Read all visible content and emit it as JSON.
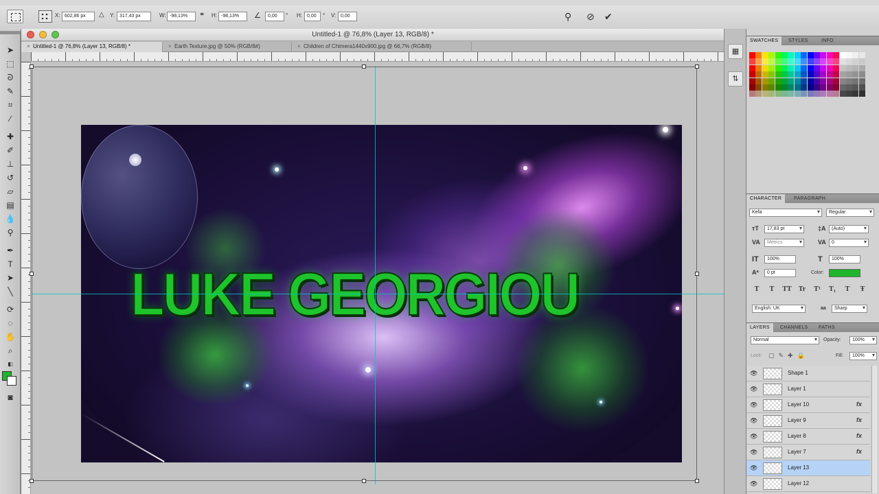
{
  "options_bar": {
    "x_label": "X:",
    "x_value": "602,86 px",
    "y_label": "Y:",
    "y_value": "317,43 px",
    "w_label": "W:",
    "w_value": "-98,13%",
    "h_label": "H:",
    "h_value": "-98,13%",
    "angle_value": "0,00",
    "hskew_label": "H:",
    "hskew_value": "0,00",
    "vskew_label": "V:",
    "vskew_value": "0,00",
    "degree_symbol": "°",
    "degree_symbol_2": "°",
    "warp_icon": "warp-mode-icon",
    "cancel_icon": "cancel-transform-icon",
    "commit_icon": "commit-transform-icon"
  },
  "document": {
    "title": "Untitled-1 @ 76,8% (Layer 13, RGB/8) *",
    "tabs": [
      {
        "label": "Untitled-1 @ 76,8% (Layer 13, RGB/8) *",
        "active": true
      },
      {
        "label": "Earth Texture.jpg @ 50% (RGB/8#)",
        "active": false
      },
      {
        "label": "Children of Chimera1440x900.jpg @ 66,7% (RGB/8)",
        "active": false
      }
    ],
    "canvas_text": "LUKE GEORGIOU"
  },
  "panels": {
    "swatches_tabs": [
      "SWATCHES",
      "STYLES",
      "INFO"
    ],
    "character_tabs": [
      "CHARACTER",
      "PARAGRAPH"
    ],
    "character": {
      "font_family": "Kefa",
      "font_style": "Regular",
      "font_size": "17,83 pt",
      "leading": "(Auto)",
      "kerning": "Metrics",
      "tracking": "0",
      "vertical_scale": "100%",
      "horizontal_scale": "100%",
      "baseline_shift": "0 pt",
      "color_label": "Color:",
      "color_value": "#1fb52c",
      "style_buttons": [
        "T",
        "T",
        "TT",
        "Tr",
        "T¹",
        "T₁",
        "T",
        "Ŧ"
      ],
      "language": "English: UK",
      "aa_label": "aa",
      "antialias": "Sharp"
    },
    "layers_tabs": [
      "LAYERS",
      "CHANNELS",
      "PATHS"
    ],
    "layers": {
      "blend_mode": "Normal",
      "opacity_label": "Opacity:",
      "opacity": "100%",
      "lock_label": "Lock:",
      "fill_label": "Fill:",
      "fill": "100%",
      "items": [
        {
          "name": "Shape 1",
          "fx": false,
          "selected": false
        },
        {
          "name": "Layer 1",
          "fx": false,
          "selected": false
        },
        {
          "name": "Layer 10",
          "fx": true,
          "selected": false
        },
        {
          "name": "Layer 9",
          "fx": true,
          "selected": false
        },
        {
          "name": "Layer 8",
          "fx": true,
          "selected": false
        },
        {
          "name": "Layer 7",
          "fx": true,
          "selected": false
        },
        {
          "name": "Layer 13",
          "fx": false,
          "selected": true
        },
        {
          "name": "Layer 12",
          "fx": false,
          "selected": false
        }
      ],
      "fx_label": "fx"
    }
  },
  "colors": {
    "foreground": "#1fb52c",
    "background": "#ffffff",
    "layer_selected": "#b6d3f6",
    "guide": "#00c8c8"
  }
}
